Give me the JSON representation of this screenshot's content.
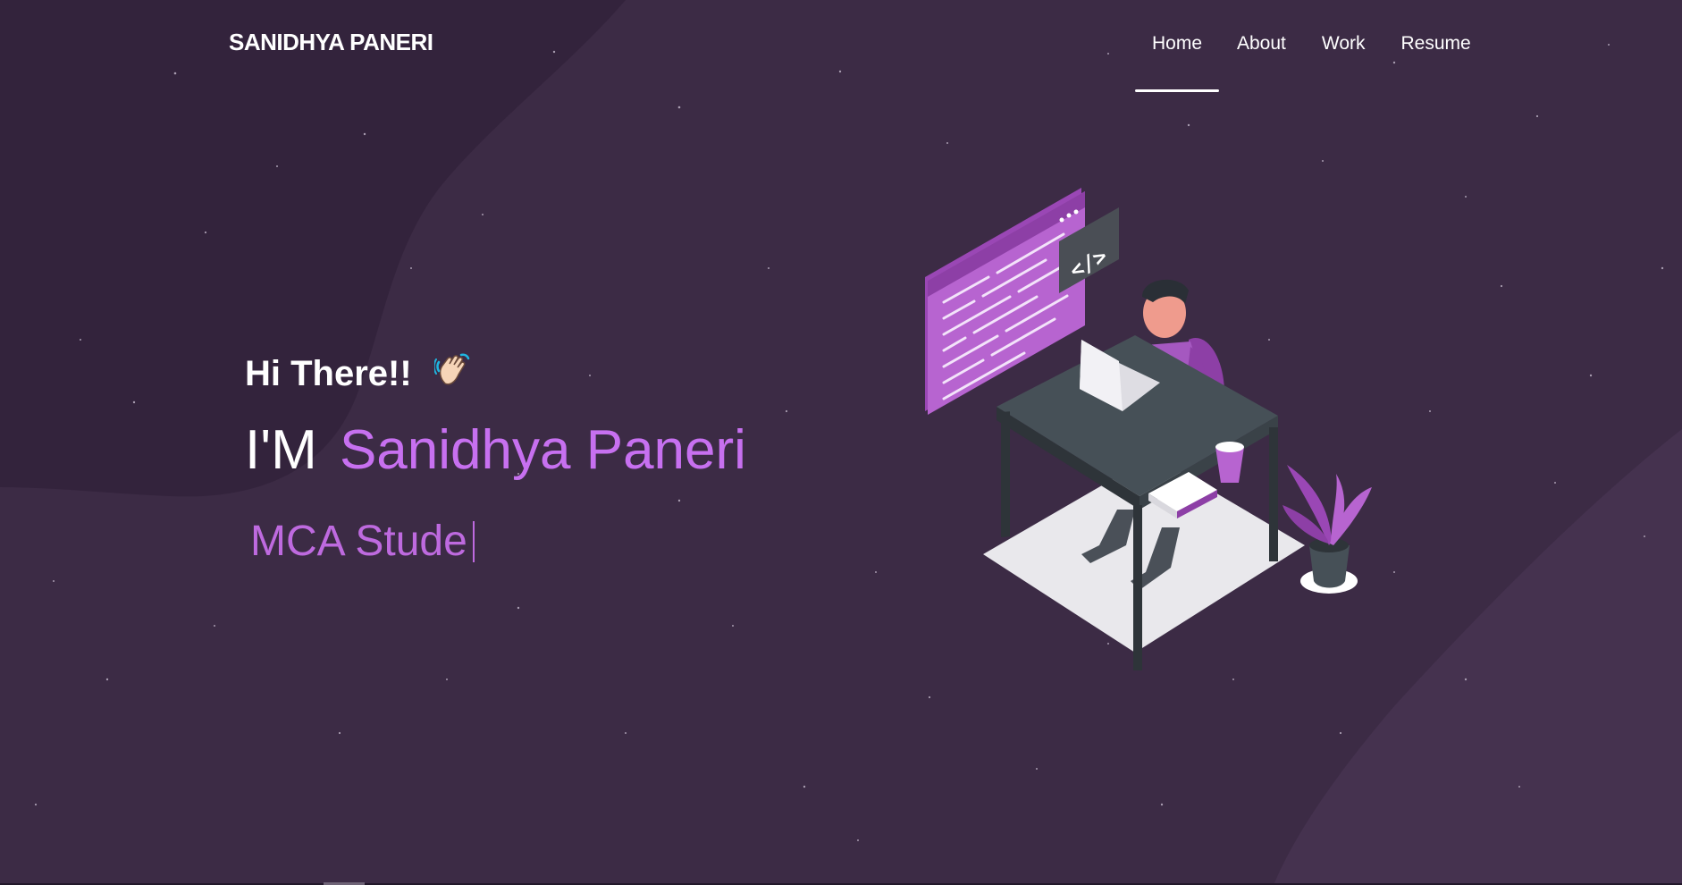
{
  "brand": {
    "label": "SANIDHYA PANERI"
  },
  "nav": {
    "items": [
      {
        "label": "Home",
        "active": true
      },
      {
        "label": "About",
        "active": false
      },
      {
        "label": "Work",
        "active": false
      },
      {
        "label": "Resume",
        "active": false
      }
    ]
  },
  "hero": {
    "greeting": "Hi There!!",
    "wave_icon": "waving-hand-icon",
    "intro_prefix": "I'M",
    "name": "Sanidhya Paneri",
    "typed_text": "MCA Stude"
  },
  "illustration": {
    "icon": "developer-at-desk-illustration",
    "code_tag": "</>"
  },
  "colors": {
    "background": "#3c2b45",
    "background_dark": "#33233c",
    "accent": "#c770f0",
    "typed": "#be6adf",
    "text": "#ffffff"
  }
}
